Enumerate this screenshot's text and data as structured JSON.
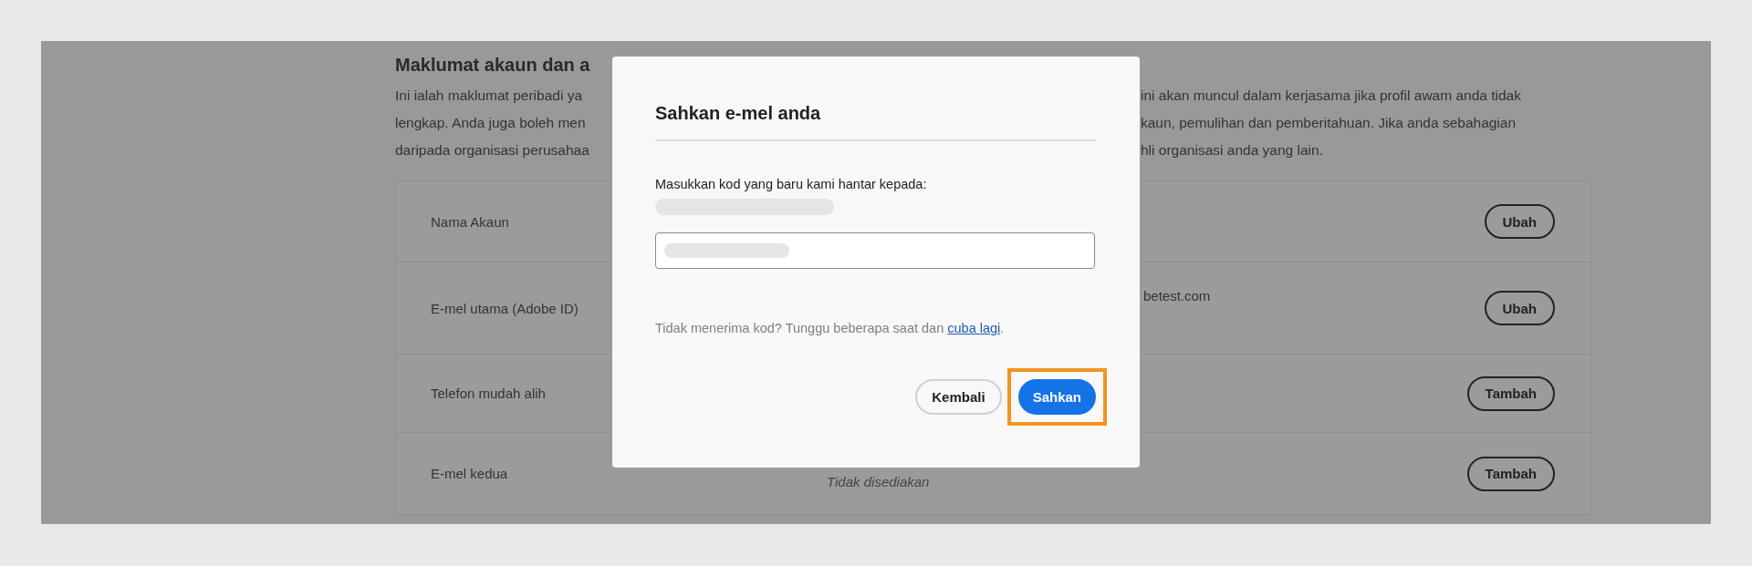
{
  "page": {
    "heading": "Maklumat akaun dan a",
    "paragraph_lines": [
      {
        "left": "Ini ialah maklumat peribadi ya",
        "right": "ini akan muncul dalam kerjasama jika profil awam anda tidak"
      },
      {
        "left": "lengkap. Anda juga boleh men",
        "right": "kaun, pemulihan dan pemberitahuan. Jika anda sebahagian"
      },
      {
        "left": "daripada organisasi perusahaa",
        "right": "hli organisasi anda yang lain."
      }
    ],
    "rows": [
      {
        "label": "Nama Akaun",
        "button": "Ubah"
      },
      {
        "label": "E-mel utama (Adobe ID)",
        "value": "betest.com",
        "kind": "email",
        "button": "Ubah"
      },
      {
        "label": "Telefon mudah alih",
        "button": "Tambah"
      },
      {
        "label": "E-mel kedua",
        "value": "Tidak disediakan",
        "kind": "empty",
        "button": "Tambah"
      }
    ]
  },
  "dialog": {
    "title": "Sahkan e-mel anda",
    "prompt": "Masukkan kod yang baru kami hantar kepada:",
    "help_text": "Tidak menerima kod? Tunggu beberapa saat dan ",
    "help_link": "cuba lagi",
    "help_end": ".",
    "buttons": [
      {
        "label": "Kembali",
        "kind": "secondary",
        "highlighted": false
      },
      {
        "label": "Sahkan",
        "kind": "primary",
        "highlighted": true
      }
    ]
  }
}
